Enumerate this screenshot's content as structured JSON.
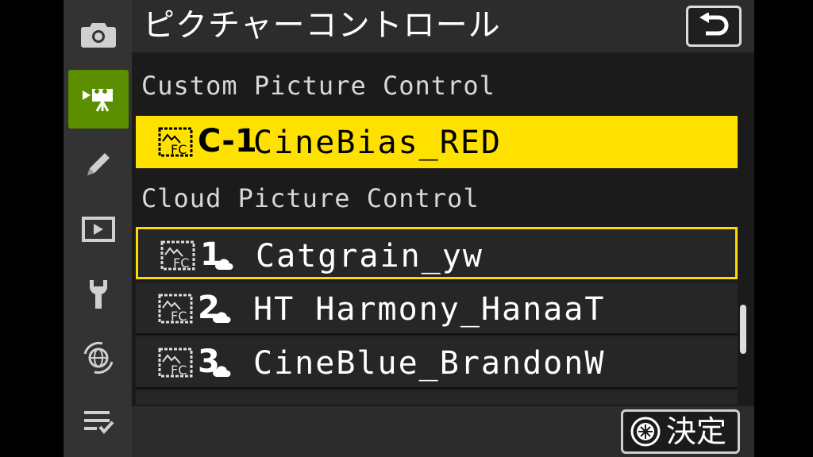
{
  "colors": {
    "sidebar_bg": "#333333",
    "active_tab": "#5b8f00",
    "highlight_yellow": "#ffe100",
    "focus_border": "#ffd900",
    "row_bg": "#262626"
  },
  "sidebar": {
    "items": [
      {
        "icon": "camera-icon"
      },
      {
        "icon": "movie-camera-icon",
        "active": true
      },
      {
        "icon": "pencil-icon"
      },
      {
        "icon": "playback-icon"
      },
      {
        "icon": "wrench-icon"
      },
      {
        "icon": "network-icon"
      },
      {
        "icon": "my-menu-icon"
      }
    ]
  },
  "header": {
    "title": "ピクチャーコントロール",
    "back_icon": "return-icon"
  },
  "sections": {
    "custom_label": "Custom Picture Control",
    "cloud_label": "Cloud Picture Control"
  },
  "rows": [
    {
      "slot": "C-1",
      "name": "CineBias_RED",
      "state": "selected"
    },
    {
      "slot": "1",
      "name": "Catgrain_yw",
      "state": "focused",
      "cloud": true
    },
    {
      "slot": "2",
      "name": "HT Harmony_HanaaT",
      "cloud": true
    },
    {
      "slot": "3",
      "name": "CineBlue_BrandonW",
      "cloud": true
    }
  ],
  "footer": {
    "ok_label": "決定",
    "ok_icon": "multi-selector-icon"
  }
}
